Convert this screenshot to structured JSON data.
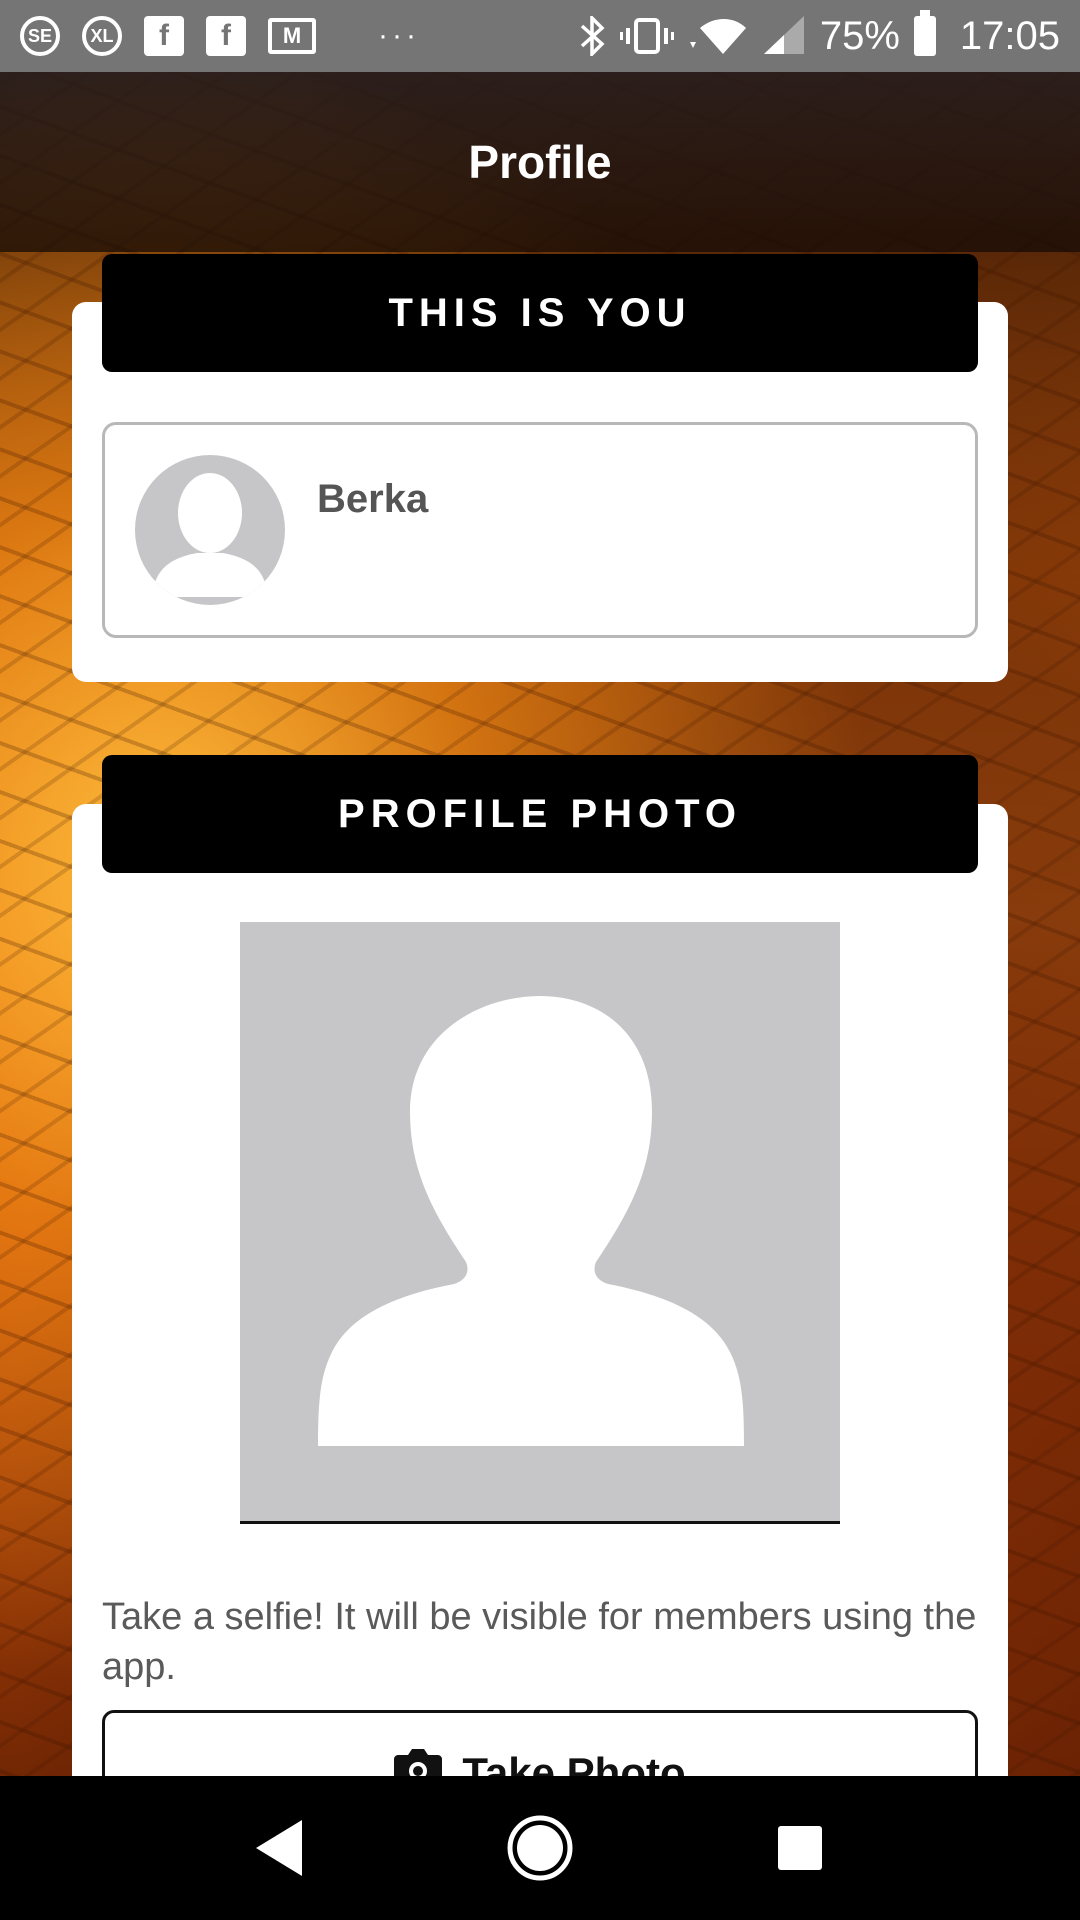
{
  "status_bar": {
    "left_icons": [
      "se-app-icon",
      "xl-search-icon",
      "facebook-icon",
      "facebook-icon",
      "gmail-icon"
    ],
    "left_icon_texts": [
      "SE",
      "XL",
      "f",
      "f",
      "M"
    ],
    "overflow": "···",
    "battery_percent": "75%",
    "time": "17:05"
  },
  "header": {
    "title": "Profile"
  },
  "this_is_you": {
    "heading": "THIS IS YOU",
    "user_name": "Berka"
  },
  "profile_photo": {
    "heading": "PROFILE PHOTO",
    "description": "Take a selfie! It will be visible for members using the app.",
    "take_photo_label": "Take Photo"
  },
  "colors": {
    "card_header_bg": "#000000",
    "placeholder_bg": "#c6c5c7",
    "status_bar_bg": "#757575"
  }
}
